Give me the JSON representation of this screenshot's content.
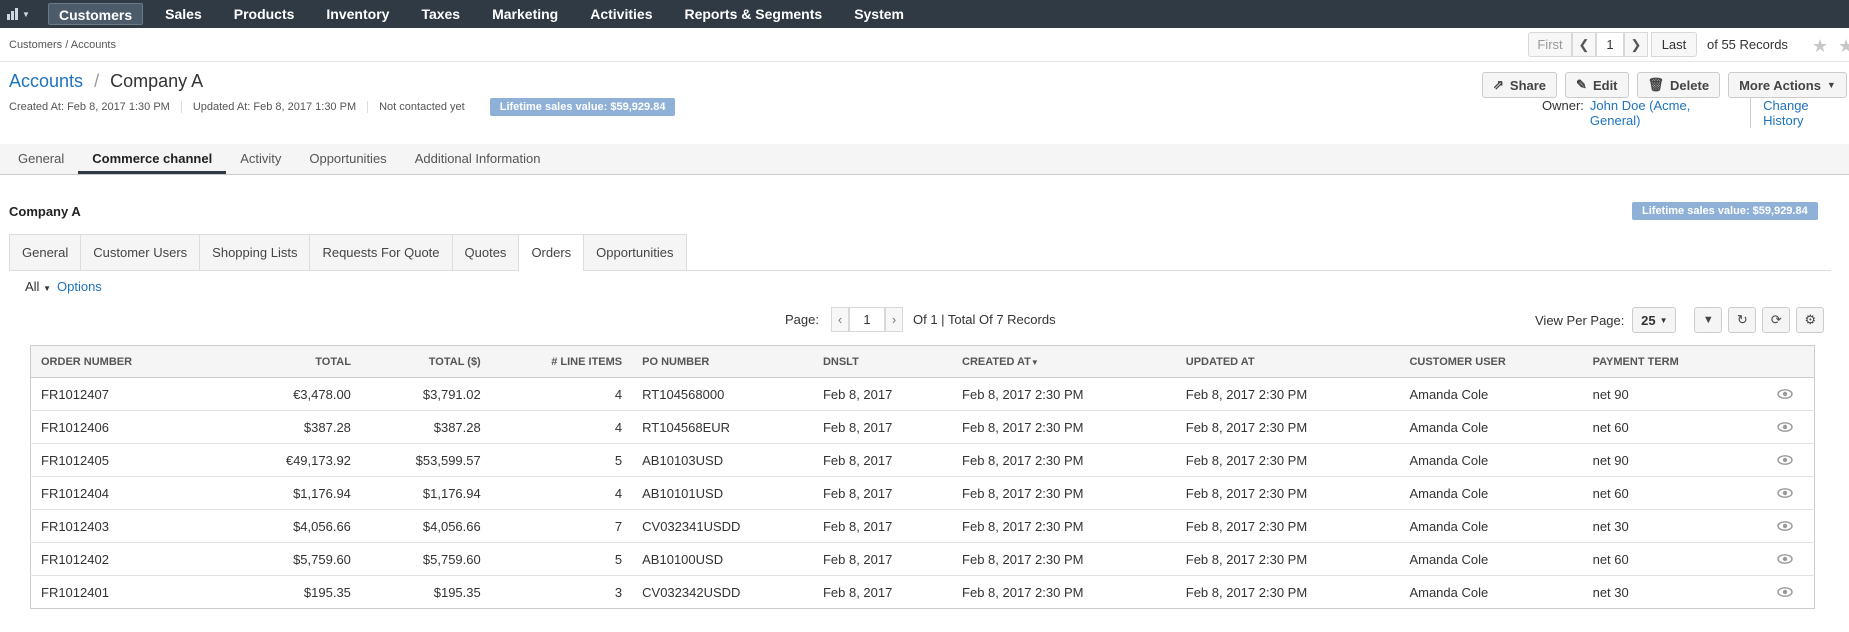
{
  "nav": {
    "menu": [
      "Customers",
      "Sales",
      "Products",
      "Inventory",
      "Taxes",
      "Marketing",
      "Activities",
      "Reports & Segments",
      "System"
    ],
    "active": "Customers"
  },
  "breadcrumb": "Customers / Accounts",
  "pager_top": {
    "first": "First",
    "page": "1",
    "last": "Last",
    "of": "of 55 Records"
  },
  "header": {
    "entity_link": "Accounts",
    "separator": "/",
    "name": "Company A",
    "created": "Created At: Feb 8, 2017 1:30 PM",
    "updated": "Updated At: Feb 8, 2017 1:30 PM",
    "contacted": "Not contacted yet",
    "lifetime": "Lifetime sales value: $59,929.84",
    "owner_label": "Owner:",
    "owner": "John Doe (Acme, General)",
    "change_history": "Change History"
  },
  "actions": {
    "share": "Share",
    "edit": "Edit",
    "delete": "Delete",
    "more": "More Actions"
  },
  "main_tabs": [
    "General",
    "Commerce channel",
    "Activity",
    "Opportunities",
    "Additional Information"
  ],
  "main_tab_active": "Commerce channel",
  "section": {
    "title": "Company A",
    "lifetime": "Lifetime sales value: $59,929.84"
  },
  "sub_tabs": [
    "General",
    "Customer Users",
    "Shopping Lists",
    "Requests For Quote",
    "Quotes",
    "Orders",
    "Opportunities"
  ],
  "sub_tab_active": "Orders",
  "filter": {
    "all": "All",
    "options": "Options"
  },
  "grid_pager": {
    "label": "Page:",
    "page": "1",
    "total": "Of 1 | Total Of 7 Records"
  },
  "grid_tools": {
    "view_per_page": "View Per Page:",
    "per_page": "25"
  },
  "table": {
    "columns": [
      "ORDER NUMBER",
      "TOTAL",
      "TOTAL ($)",
      "# LINE ITEMS",
      "PO NUMBER",
      "DNSLT",
      "CREATED AT",
      "UPDATED AT",
      "CUSTOMER USER",
      "PAYMENT TERM"
    ],
    "rows": [
      [
        "FR1012407",
        "€3,478.00",
        "$3,791.02",
        "4",
        "RT104568000",
        "Feb 8, 2017",
        "Feb 8, 2017 2:30 PM",
        "Feb 8, 2017 2:30 PM",
        "Amanda Cole",
        "net 90"
      ],
      [
        "FR1012406",
        "$387.28",
        "$387.28",
        "4",
        "RT104568EUR",
        "Feb 8, 2017",
        "Feb 8, 2017 2:30 PM",
        "Feb 8, 2017 2:30 PM",
        "Amanda Cole",
        "net 60"
      ],
      [
        "FR1012405",
        "€49,173.92",
        "$53,599.57",
        "5",
        "AB10103USD",
        "Feb 8, 2017",
        "Feb 8, 2017 2:30 PM",
        "Feb 8, 2017 2:30 PM",
        "Amanda Cole",
        "net 90"
      ],
      [
        "FR1012404",
        "$1,176.94",
        "$1,176.94",
        "4",
        "AB10101USD",
        "Feb 8, 2017",
        "Feb 8, 2017 2:30 PM",
        "Feb 8, 2017 2:30 PM",
        "Amanda Cole",
        "net 60"
      ],
      [
        "FR1012403",
        "$4,056.66",
        "$4,056.66",
        "7",
        "CV032341USDD",
        "Feb 8, 2017",
        "Feb 8, 2017 2:30 PM",
        "Feb 8, 2017 2:30 PM",
        "Amanda Cole",
        "net 30"
      ],
      [
        "FR1012402",
        "$5,759.60",
        "$5,759.60",
        "5",
        "AB10100USD",
        "Feb 8, 2017",
        "Feb 8, 2017 2:30 PM",
        "Feb 8, 2017 2:30 PM",
        "Amanda Cole",
        "net 60"
      ],
      [
        "FR1012401",
        "$195.35",
        "$195.35",
        "3",
        "CV032342USDD",
        "Feb 8, 2017",
        "Feb 8, 2017 2:30 PM",
        "Feb 8, 2017 2:30 PM",
        "Amanda Cole",
        "net 30"
      ]
    ]
  }
}
